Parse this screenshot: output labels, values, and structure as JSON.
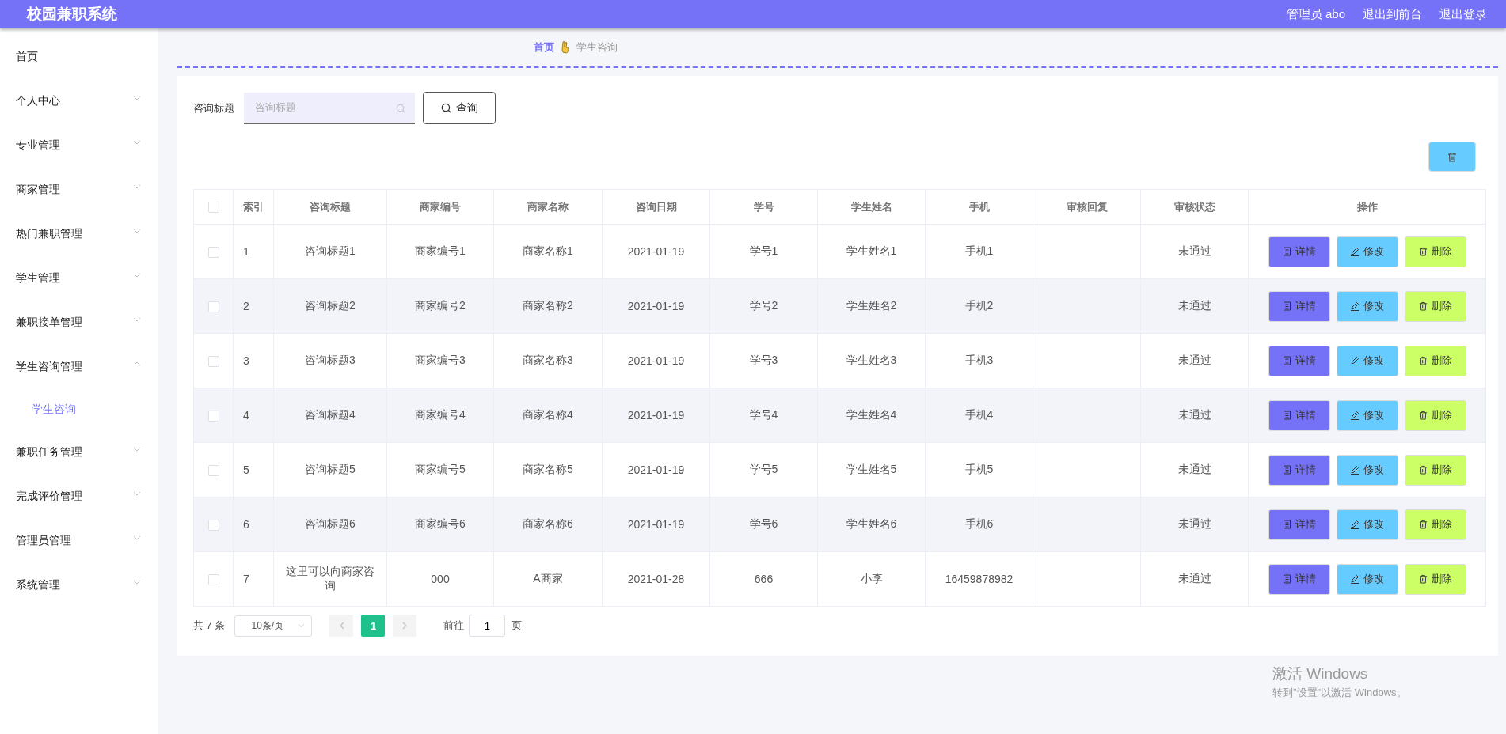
{
  "header": {
    "title": "校园兼职系统",
    "links": [
      "管理员 abo",
      "退出到前台",
      "退出登录"
    ]
  },
  "sidebar": {
    "items": [
      {
        "label": "首页",
        "kind": "link"
      },
      {
        "label": "个人中心",
        "kind": "menu",
        "expanded": false
      },
      {
        "label": "专业管理",
        "kind": "menu",
        "expanded": false
      },
      {
        "label": "商家管理",
        "kind": "menu",
        "expanded": false
      },
      {
        "label": "热门兼职管理",
        "kind": "menu",
        "expanded": false
      },
      {
        "label": "学生管理",
        "kind": "menu",
        "expanded": false
      },
      {
        "label": "兼职接单管理",
        "kind": "menu",
        "expanded": false
      },
      {
        "label": "学生咨询管理",
        "kind": "menu",
        "expanded": true,
        "children": [
          {
            "label": "学生咨询",
            "selected": true
          }
        ]
      },
      {
        "label": "兼职任务管理",
        "kind": "menu",
        "expanded": false
      },
      {
        "label": "完成评价管理",
        "kind": "menu",
        "expanded": false
      },
      {
        "label": "管理员管理",
        "kind": "menu",
        "expanded": false
      },
      {
        "label": "系统管理",
        "kind": "menu",
        "expanded": false
      }
    ]
  },
  "breadcrumb": [
    "首页",
    "学生咨询"
  ],
  "search": {
    "label": "咨询标题",
    "placeholder": "咨询标题",
    "button": "查询"
  },
  "table": {
    "columns": [
      "索引",
      "咨询标题",
      "商家编号",
      "商家名称",
      "咨询日期",
      "学号",
      "学生姓名",
      "手机",
      "审核回复",
      "审核状态",
      "操作"
    ],
    "all_checked": false,
    "rows": [
      {
        "checked": false,
        "cells": [
          "1",
          "咨询标题1",
          "商家编号1",
          "商家名称1",
          "2021-01-19",
          "学号1",
          "学生姓名1",
          "手机1",
          "",
          "未通过"
        ],
        "actions": [
          {
            "kind": "detail",
            "label": "详情"
          },
          {
            "kind": "edit",
            "label": "修改"
          },
          {
            "kind": "delete",
            "label": "删除"
          }
        ]
      },
      {
        "checked": false,
        "cells": [
          "2",
          "咨询标题2",
          "商家编号2",
          "商家名称2",
          "2021-01-19",
          "学号2",
          "学生姓名2",
          "手机2",
          "",
          "未通过"
        ],
        "actions": [
          {
            "kind": "detail",
            "label": "详情"
          },
          {
            "kind": "edit",
            "label": "修改"
          },
          {
            "kind": "delete",
            "label": "删除"
          }
        ]
      },
      {
        "checked": false,
        "cells": [
          "3",
          "咨询标题3",
          "商家编号3",
          "商家名称3",
          "2021-01-19",
          "学号3",
          "学生姓名3",
          "手机3",
          "",
          "未通过"
        ],
        "actions": [
          {
            "kind": "detail",
            "label": "详情"
          },
          {
            "kind": "edit",
            "label": "修改"
          },
          {
            "kind": "delete",
            "label": "删除"
          }
        ]
      },
      {
        "checked": false,
        "cells": [
          "4",
          "咨询标题4",
          "商家编号4",
          "商家名称4",
          "2021-01-19",
          "学号4",
          "学生姓名4",
          "手机4",
          "",
          "未通过"
        ],
        "actions": [
          {
            "kind": "detail",
            "label": "详情"
          },
          {
            "kind": "edit",
            "label": "修改"
          },
          {
            "kind": "delete",
            "label": "删除"
          }
        ]
      },
      {
        "checked": false,
        "cells": [
          "5",
          "咨询标题5",
          "商家编号5",
          "商家名称5",
          "2021-01-19",
          "学号5",
          "学生姓名5",
          "手机5",
          "",
          "未通过"
        ],
        "actions": [
          {
            "kind": "detail",
            "label": "详情"
          },
          {
            "kind": "edit",
            "label": "修改"
          },
          {
            "kind": "delete",
            "label": "删除"
          }
        ]
      },
      {
        "checked": false,
        "cells": [
          "6",
          "咨询标题6",
          "商家编号6",
          "商家名称6",
          "2021-01-19",
          "学号6",
          "学生姓名6",
          "手机6",
          "",
          "未通过"
        ],
        "actions": [
          {
            "kind": "detail",
            "label": "详情"
          },
          {
            "kind": "edit",
            "label": "修改"
          },
          {
            "kind": "delete",
            "label": "删除"
          }
        ]
      },
      {
        "checked": false,
        "cells": [
          "7",
          "这里可以向商家咨询",
          "000",
          "A商家",
          "2021-01-28",
          "666",
          "小李",
          "16459878982",
          "",
          "未通过"
        ],
        "actions": [
          {
            "kind": "detail",
            "label": "详情"
          },
          {
            "kind": "edit",
            "label": "修改"
          },
          {
            "kind": "delete",
            "label": "删除"
          }
        ]
      }
    ]
  },
  "pagination": {
    "total": "共 7 条",
    "page_size": "10条/页",
    "pages": [
      {
        "label": "1",
        "selected": true
      }
    ],
    "goto_label": "前往",
    "goto_value": "1",
    "goto_suffix": "页"
  },
  "os_notice": {
    "title": "激活 Windows",
    "text": "转到\"设置\"以激活 Windows。"
  }
}
